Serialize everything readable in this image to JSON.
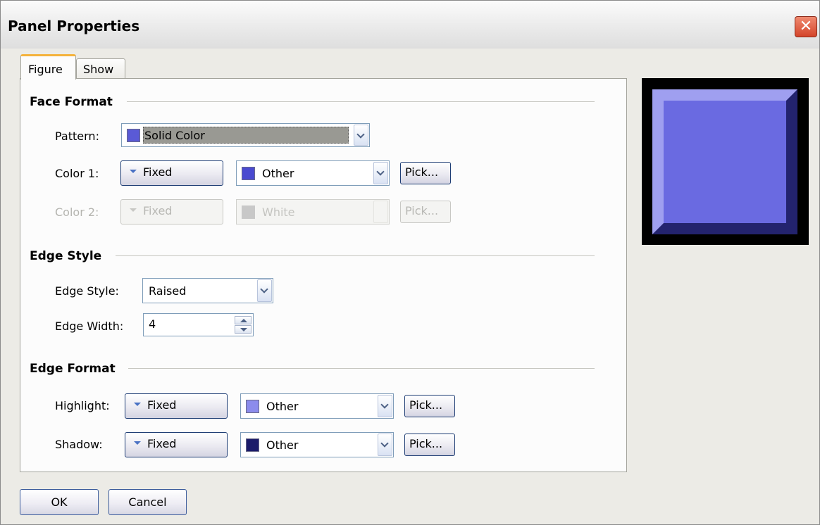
{
  "window": {
    "title": "Panel Properties",
    "close_glyph": "✕"
  },
  "tabs": [
    "Figure",
    "Show"
  ],
  "face_format": {
    "title": "Face Format",
    "pattern": {
      "label": "Pattern:",
      "value": "Solid Color",
      "swatch": "#5a5ad6"
    },
    "color1": {
      "label": "Color 1:",
      "mode": "Fixed",
      "value": "Other",
      "swatch": "#4a4ad0",
      "pick": "Pick..."
    },
    "color2": {
      "label": "Color 2:",
      "mode": "Fixed",
      "value": "White",
      "swatch": "#c8c8c8",
      "pick": "Pick..."
    }
  },
  "edge_style": {
    "title": "Edge Style",
    "style": {
      "label": "Edge Style:",
      "value": "Raised"
    },
    "width": {
      "label": "Edge Width:",
      "value": "4"
    }
  },
  "edge_format": {
    "title": "Edge Format",
    "highlight": {
      "label": "Highlight:",
      "mode": "Fixed",
      "value": "Other",
      "swatch": "#8c8cec",
      "pick": "Pick..."
    },
    "shadow": {
      "label": "Shadow:",
      "mode": "Fixed",
      "value": "Other",
      "swatch": "#1c1c6a",
      "pick": "Pick..."
    }
  },
  "preview": {
    "face": "#6a6ae1",
    "highlight": "#9f9ff0",
    "shadow": "#23236e"
  },
  "buttons": {
    "ok": "OK",
    "cancel": "Cancel"
  }
}
